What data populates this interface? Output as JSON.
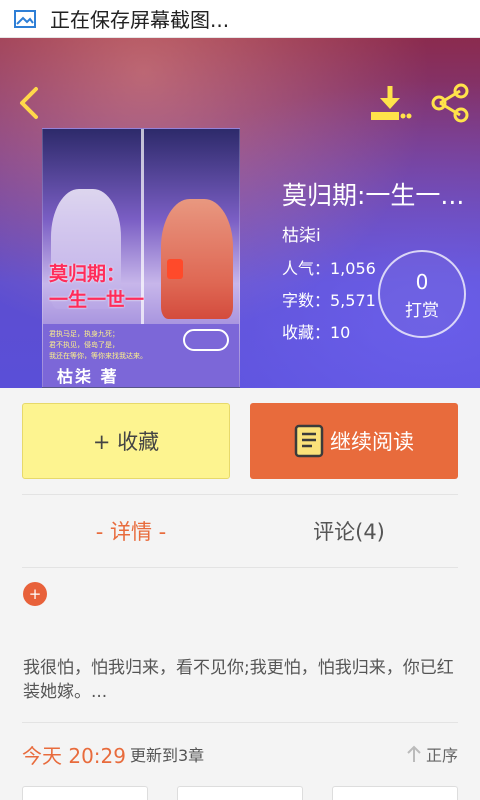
{
  "status_bar": {
    "icon": "image-icon",
    "text": "正在保存屏幕截图..."
  },
  "header": {
    "back_icon": "chevron-left-icon",
    "download_icon": "download-icon",
    "share_icon": "share-icon"
  },
  "cover": {
    "title_line1": "莫归期：",
    "title_line2": "一生一世一",
    "poem_line1": "君执马足，执身九死；",
    "poem_line2": "君不执见，侵岛了是，",
    "poem_line3": "我还在等你，等你来找我达来。",
    "author": "枯柒 著"
  },
  "book": {
    "title": "莫归期:一生一...",
    "author": "枯柒i",
    "popularity": "人气：1,056",
    "word_count": "字数：5,571",
    "favorites": "收藏：10"
  },
  "reward": {
    "count": "0",
    "label": "打赏"
  },
  "actions": {
    "favorite_label": "+ 收藏",
    "read_label": "继续阅读"
  },
  "tabs": [
    {
      "label": "- 详情 -",
      "active": true
    },
    {
      "label": "评论(4)",
      "active": false
    }
  ],
  "expand_label": "+",
  "description": "我很怕，怕我归来，看不见你;我更怕，怕我归来，你已红装她嫁。...",
  "update": {
    "time": "今天 20:29",
    "text": "更新到3章",
    "sort_label": "正序"
  },
  "colors": {
    "accent": "#e86b3c",
    "favorite_bg": "#fdf490",
    "hero_top": "#8b2b4e",
    "hero_bottom": "#5a4fd8"
  }
}
